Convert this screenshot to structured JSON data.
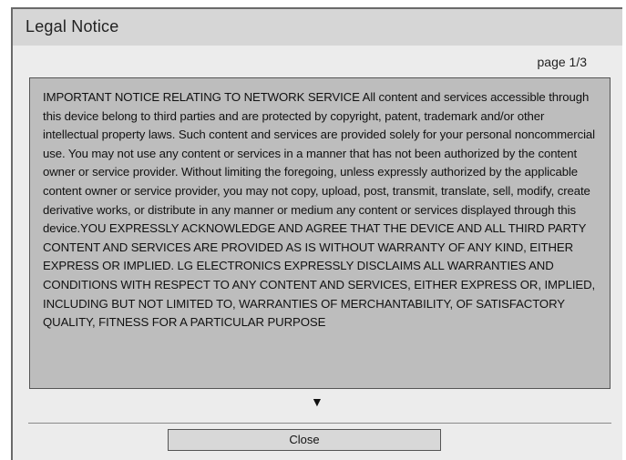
{
  "dialog": {
    "title": "Legal Notice",
    "page_indicator": "page 1/3",
    "notice_text": "IMPORTANT NOTICE RELATING TO NETWORK SERVICE All content and services accessible through this device belong to third parties and are protected by copyright, patent, trademark and/or other intellectual property laws. Such content and services are provided solely for your personal noncommercial use. You may not use any content or services in a manner that has not been authorized by the content owner or service provider. Without limiting the foregoing, unless expressly authorized by the applicable content owner or service provider, you may not copy, upload, post, transmit, translate, sell, modify, create derivative works, or distribute in any manner or medium any content or services displayed through this device.YOU EXPRESSLY ACKNOWLEDGE AND AGREE THAT THE DEVICE AND ALL THIRD PARTY CONTENT AND SERVICES ARE PROVIDED AS IS WITHOUT WARRANTY OF ANY KIND, EITHER EXPRESS OR IMPLIED. LG ELECTRONICS EXPRESSLY DISCLAIMS ALL WARRANTIES AND CONDITIONS WITH RESPECT TO ANY CONTENT AND SERVICES, EITHER EXPRESS OR, IMPLIED, INCLUDING BUT NOT LIMITED TO, WARRANTIES OF MERCHANTABILITY, OF SATISFACTORY QUALITY, FITNESS FOR A PARTICULAR PURPOSE",
    "scroll_down_icon": "▼",
    "close_label": "Close"
  },
  "icons": {
    "scroll_down": "triangle-down-icon"
  },
  "colors": {
    "title_bar": "#d6d6d6",
    "dialog_bg": "#ececec",
    "text_box_bg": "#bdbdbd",
    "button_bg": "#d8d8d8"
  }
}
